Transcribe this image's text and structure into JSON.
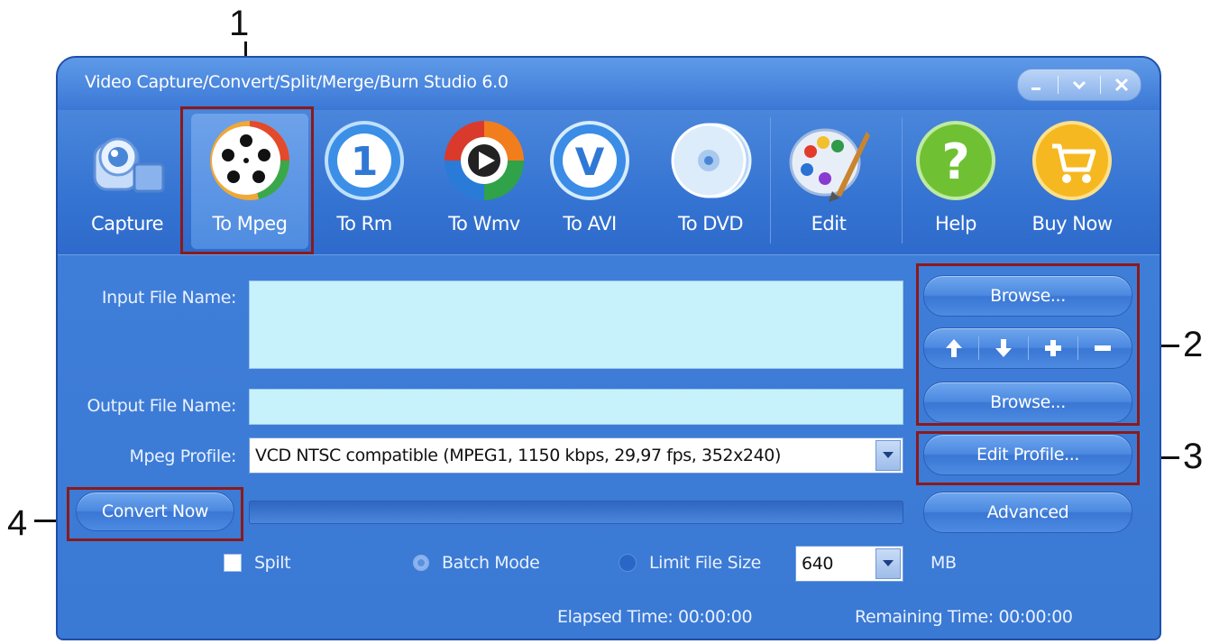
{
  "window": {
    "title": "Video Capture/Convert/Split/Merge/Burn Studio 6.0"
  },
  "toolbar": {
    "items": [
      {
        "label": "Capture",
        "icon": "camera-icon"
      },
      {
        "label": "To Mpeg",
        "icon": "film-reel-icon"
      },
      {
        "label": "To Rm",
        "icon": "realmedia-icon"
      },
      {
        "label": "To Wmv",
        "icon": "windows-media-icon"
      },
      {
        "label": "To AVI",
        "icon": "avi-icon"
      },
      {
        "label": "To DVD",
        "icon": "dvd-icon"
      },
      {
        "label": "Edit",
        "icon": "palette-icon"
      },
      {
        "label": "Help",
        "icon": "help-icon"
      },
      {
        "label": "Buy Now",
        "icon": "cart-icon"
      }
    ],
    "active": "To Mpeg"
  },
  "form": {
    "input_label": "Input File Name:",
    "input_value": "",
    "output_label": "Output File Name:",
    "output_value": "",
    "profile_label": "Mpeg Profile:",
    "profile_value": "VCD NTSC compatible (MPEG1, 1150 kbps, 29,97 fps, 352x240)"
  },
  "buttons": {
    "browse_input": "Browse...",
    "browse_output": "Browse...",
    "edit_profile": "Edit Profile...",
    "advanced": "Advanced",
    "convert_now": "Convert Now"
  },
  "options": {
    "split_label": "Spilt",
    "batch_label": "Batch Mode",
    "limit_label": "Limit File Size",
    "size_value": "640",
    "size_unit": "MB"
  },
  "status": {
    "elapsed": "Elapsed Time: 00:00:00",
    "remaining": "Remaining Time: 00:00:00"
  },
  "progress": 0,
  "annotations": {
    "n1": "1",
    "n2": "2",
    "n3": "3",
    "n4": "4"
  }
}
